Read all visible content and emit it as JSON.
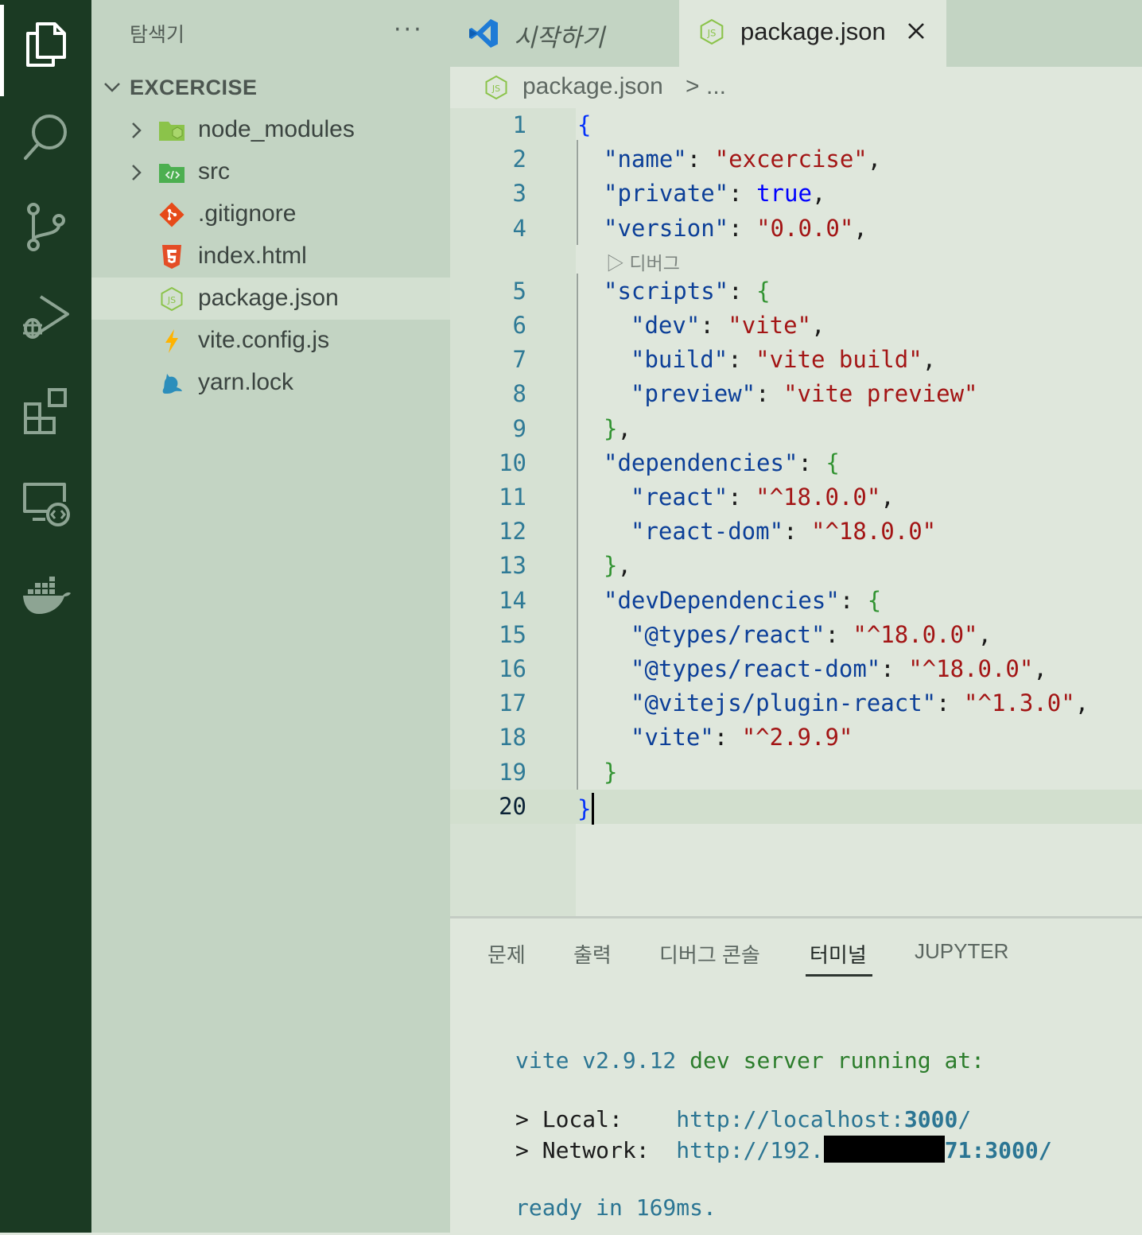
{
  "activity_bar": {
    "items": [
      "explorer-icon",
      "search-icon",
      "source-control-icon",
      "run-debug-icon",
      "extensions-icon",
      "remote-explorer-icon",
      "docker-icon"
    ]
  },
  "sidebar": {
    "title": "탐색기",
    "more": "···",
    "folder": "EXCERCISE",
    "items": [
      {
        "label": "node_modules",
        "icon": "folder-node-icon",
        "collapsible": true
      },
      {
        "label": "src",
        "icon": "folder-src-icon",
        "collapsible": true
      },
      {
        "label": ".gitignore",
        "icon": "git-icon",
        "collapsible": false
      },
      {
        "label": "index.html",
        "icon": "html5-icon",
        "collapsible": false
      },
      {
        "label": "package.json",
        "icon": "nodejs-icon",
        "collapsible": false,
        "selected": true
      },
      {
        "label": "vite.config.js",
        "icon": "vite-icon",
        "collapsible": false
      },
      {
        "label": "yarn.lock",
        "icon": "yarn-icon",
        "collapsible": false
      }
    ]
  },
  "tabs": [
    {
      "label": "시작하기",
      "icon": "vscode-icon"
    },
    {
      "label": "package.json",
      "icon": "nodejs-icon",
      "active": true
    }
  ],
  "breadcrumb": {
    "file": "package.json",
    "sep": ">",
    "more": "..."
  },
  "editor": {
    "codelens": "▷ 디버그",
    "lines": [
      "1",
      "2",
      "3",
      "4",
      "5",
      "6",
      "7",
      "8",
      "9",
      "10",
      "11",
      "12",
      "13",
      "14",
      "15",
      "16",
      "17",
      "18",
      "19",
      "20"
    ],
    "current_line": "20"
  },
  "panel": {
    "tabs": [
      "문제",
      "출력",
      "디버그 콘솔",
      "터미널",
      "JUPYTER"
    ],
    "active_tab": "터미널",
    "terminal": {
      "line1_a": "vite v2.9.12",
      "line1_b": " dev server running at:",
      "local_label": "> Local:    ",
      "local_url_a": "http://localhost:",
      "local_url_port": "3000",
      "local_url_end": "/",
      "network_label": "> Network:  ",
      "network_url_a": "http://192.",
      "network_url_b": "71:3000/",
      "ready_a": "ready in ",
      "ready_b": "169ms."
    }
  },
  "colors": {
    "activity_bg": "#1b3a23",
    "sidebar_bg": "#c3d4c3",
    "editor_bg": "#dfe7dc",
    "json_key": "#0c3f98",
    "json_string": "#a31515",
    "json_bool": "#0000ff"
  }
}
